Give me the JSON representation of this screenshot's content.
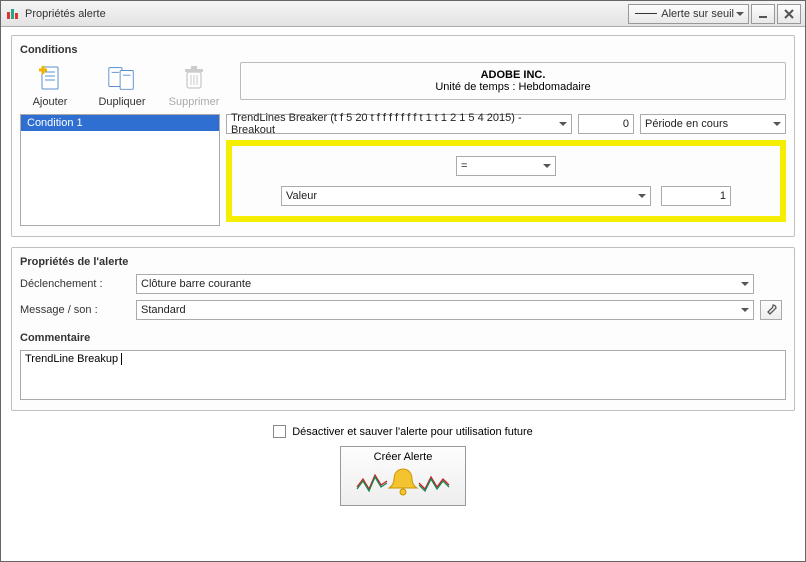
{
  "window": {
    "title": "Propriétés alerte",
    "threshold_button": "Alerte sur seuil"
  },
  "conditions": {
    "title": "Conditions",
    "toolbar": {
      "add": "Ajouter",
      "duplicate": "Dupliquer",
      "delete": "Supprimer"
    },
    "instrument": {
      "name": "ADOBE INC.",
      "timeframe": "Unité de temps : Hebdomadaire"
    },
    "list": [
      "Condition 1"
    ],
    "indicator_select": "TrendLines Breaker (t f 5 20 t f f f f f f f t 1 t 1 2 1 5 4 2015) - Breakout",
    "offset_value": "0",
    "period_select": "Période en cours",
    "operator": "=",
    "value_type": "Valeur",
    "value_num": "1"
  },
  "alert_props": {
    "title": "Propriétés de l'alerte",
    "trigger_label": "Déclenchement :",
    "trigger_value": "Clôture barre courante",
    "message_label": "Message / son :",
    "message_value": "Standard"
  },
  "comment": {
    "title": "Commentaire",
    "text": "TrendLine Breakup"
  },
  "footer": {
    "deactivate_label": "Désactiver et sauver l'alerte pour utilisation future",
    "create_label": "Créer Alerte"
  }
}
